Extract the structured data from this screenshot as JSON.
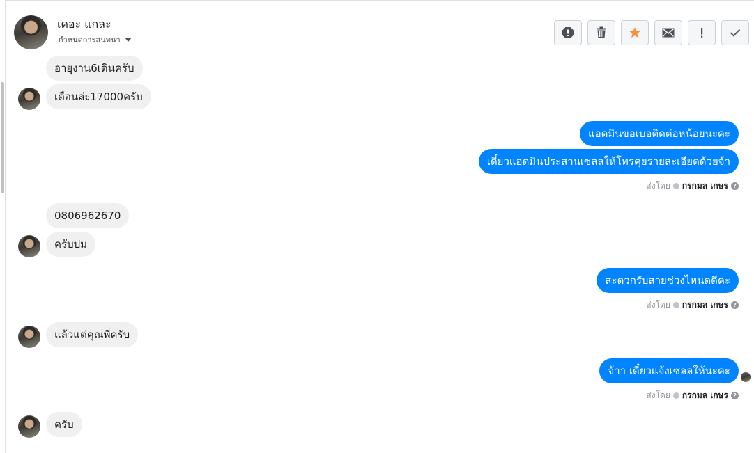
{
  "header": {
    "contact_name": "เดอะ แกละ",
    "assign_label": "กำหนดการสนทนา"
  },
  "toolbar": [
    {
      "name": "report-spam-button",
      "icon": "alert-octagon-icon"
    },
    {
      "name": "delete-button",
      "icon": "trash-icon"
    },
    {
      "name": "star-button",
      "icon": "star-icon",
      "color": "#f7923b"
    },
    {
      "name": "mark-unread-button",
      "icon": "envelope-icon"
    },
    {
      "name": "follow-up-button",
      "icon": "exclamation-icon"
    },
    {
      "name": "mark-done-button",
      "icon": "check-icon"
    }
  ],
  "messages": [
    {
      "dir": "in",
      "text": "อายุงาน6เดินครับ"
    },
    {
      "dir": "in",
      "text": "เดือนล่ะ17000ครับ"
    },
    {
      "dir": "out",
      "text": "แอดมินขอเบอติดต่อหน้อยนะคะ"
    },
    {
      "dir": "out",
      "text": "เดี๋ยวแอดมินประสานเซลลให้โทรคุยรายละเอียดด้วยจ้า"
    },
    {
      "dir": "in",
      "text": "0806962670"
    },
    {
      "dir": "in",
      "text": "ครับปม"
    },
    {
      "dir": "out",
      "text": "สะดวกรับสายช่วงไหนดดีคะ"
    },
    {
      "dir": "in",
      "text": "แล้วแต่คุณพี่ครับ"
    },
    {
      "dir": "out",
      "text": "จ้าา เดี๋ยวแจ้งเซลลให้นะคะ"
    },
    {
      "dir": "in",
      "text": "ครับ"
    }
  ],
  "sent_by": {
    "prefix": "ส่งโดย",
    "agent": "กรกมล เกษร",
    "help": "?"
  },
  "colors": {
    "outgoing_bubble": "#0084ff",
    "incoming_bubble": "#f1f0f0"
  }
}
